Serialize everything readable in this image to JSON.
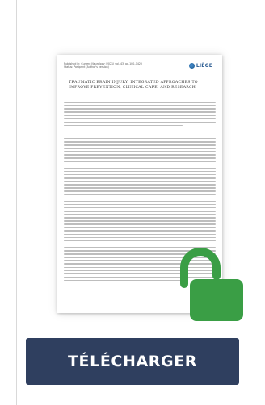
{
  "document": {
    "header_meta": "Published in: Current Neurology (2021) vol. 43, pp.100–1420\nStatus: Postprint (Author's version)",
    "logo_text": "LIÈGE",
    "title": "TRAUMATIC BRAIN INJURY: INTEGRATED APPROACHES TO IMPROVE PREVENTION, CLINICAL CARE, AND RESEARCH"
  },
  "access": {
    "icon": "open-lock-icon",
    "color": "#3a9e45"
  },
  "actions": {
    "download_label": "TÉLÉCHARGER",
    "button_color": "#2f3f5f"
  }
}
